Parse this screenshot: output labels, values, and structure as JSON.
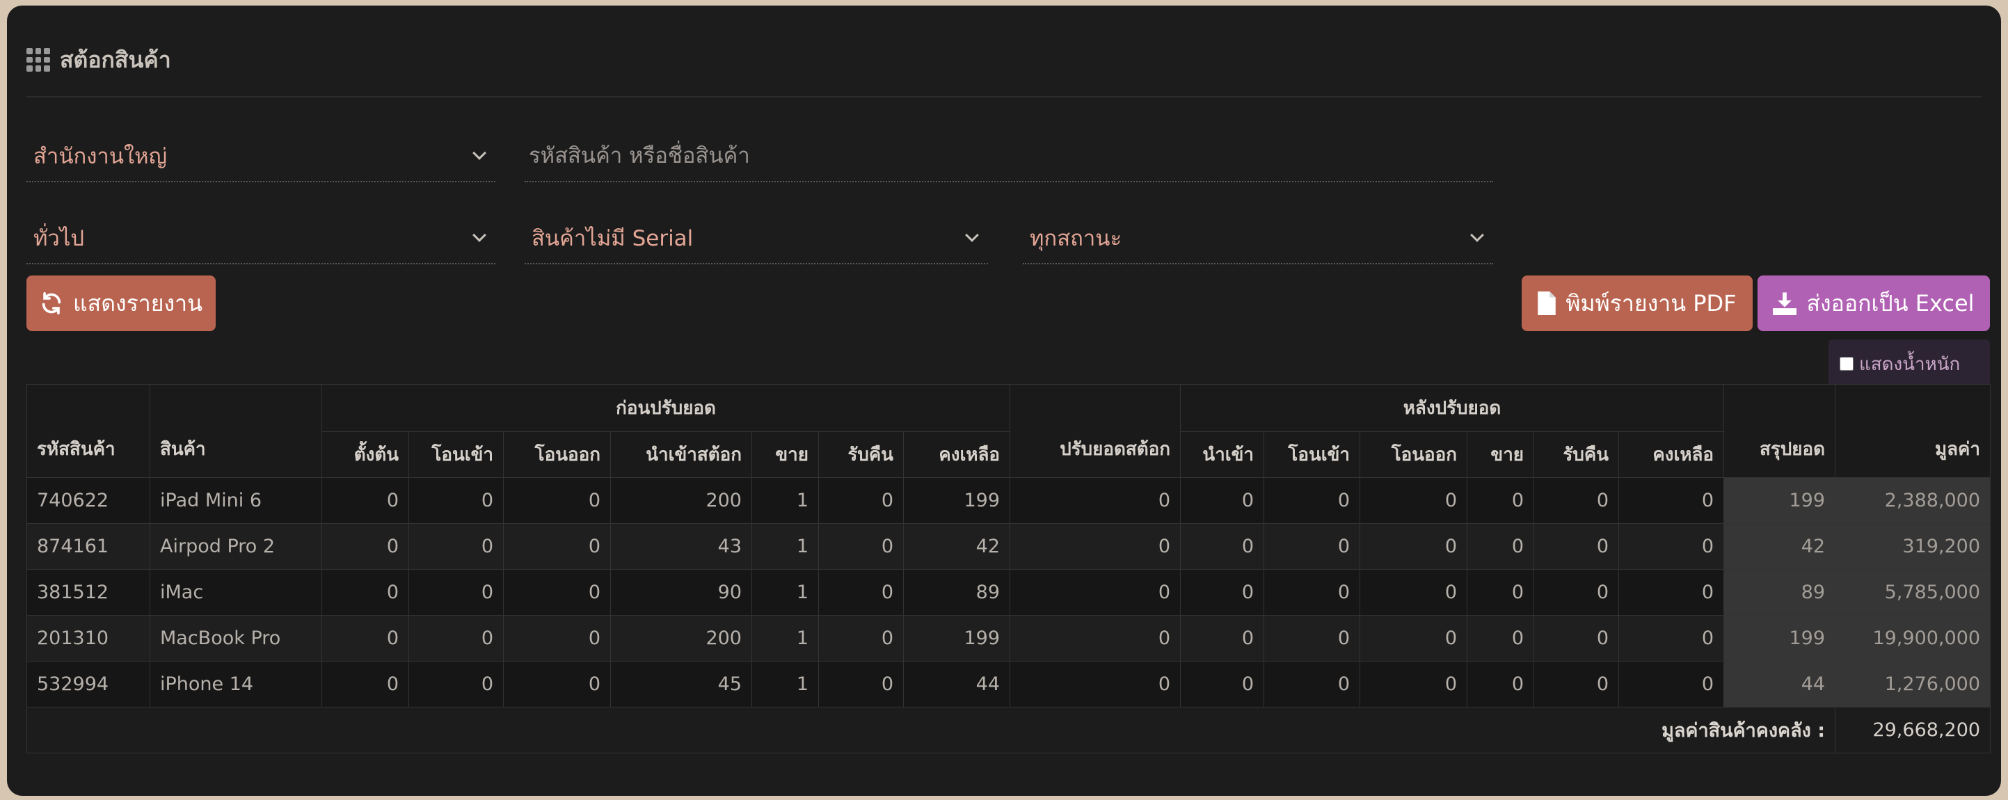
{
  "header": {
    "title": "สต้อกสินค้า",
    "icon": "grid-icon"
  },
  "filters": {
    "branch": "สำนักงานใหญ่",
    "search_placeholder": "รหัสสินค้า หรือชื่อสินค้า",
    "category": "ทั่วไป",
    "serial_type": "สินค้าไม่มี Serial",
    "status": "ทุกสถานะ"
  },
  "buttons": {
    "show_report": "แสดงรายงาน",
    "print_pdf": "พิมพ์รายงาน PDF",
    "export_excel": "ส่งออกเป็น Excel"
  },
  "options": {
    "show_weight": "แสดงน้ำหนัก"
  },
  "table": {
    "headers": {
      "code": "รหัสสินค้า",
      "product": "สินค้า",
      "before_group": "ก่อนปรับยอด",
      "adjust": "ปรับยอดสต้อก",
      "after_group": "หลังปรับยอด",
      "summary": "สรุปยอด",
      "value": "มูลค่า",
      "before": [
        "ตั้งต้น",
        "โอนเข้า",
        "โอนออก",
        "นำเข้าสต้อก",
        "ขาย",
        "รับคืน",
        "คงเหลือ"
      ],
      "after": [
        "นำเข้า",
        "โอนเข้า",
        "โอนออก",
        "ขาย",
        "รับคืน",
        "คงเหลือ"
      ]
    },
    "rows": [
      {
        "code": "740622",
        "name": "iPad Mini 6",
        "before": [
          "0",
          "0",
          "0",
          "200",
          "1",
          "0",
          "199"
        ],
        "adjust": "0",
        "after": [
          "0",
          "0",
          "0",
          "0",
          "0",
          "0"
        ],
        "summary": "199",
        "value": "2,388,000"
      },
      {
        "code": "874161",
        "name": "Airpod Pro 2",
        "before": [
          "0",
          "0",
          "0",
          "43",
          "1",
          "0",
          "42"
        ],
        "adjust": "0",
        "after": [
          "0",
          "0",
          "0",
          "0",
          "0",
          "0"
        ],
        "summary": "42",
        "value": "319,200"
      },
      {
        "code": "381512",
        "name": "iMac",
        "before": [
          "0",
          "0",
          "0",
          "90",
          "1",
          "0",
          "89"
        ],
        "adjust": "0",
        "after": [
          "0",
          "0",
          "0",
          "0",
          "0",
          "0"
        ],
        "summary": "89",
        "value": "5,785,000"
      },
      {
        "code": "201310",
        "name": "MacBook Pro",
        "before": [
          "0",
          "0",
          "0",
          "200",
          "1",
          "0",
          "199"
        ],
        "adjust": "0",
        "after": [
          "0",
          "0",
          "0",
          "0",
          "0",
          "0"
        ],
        "summary": "199",
        "value": "19,900,000"
      },
      {
        "code": "532994",
        "name": "iPhone 14",
        "before": [
          "0",
          "0",
          "0",
          "45",
          "1",
          "0",
          "44"
        ],
        "adjust": "0",
        "after": [
          "0",
          "0",
          "0",
          "0",
          "0",
          "0"
        ],
        "summary": "44",
        "value": "1,276,000"
      }
    ],
    "footer": {
      "label": "มูลค่าสินค้าคงคลัง :",
      "total": "29,668,200"
    }
  },
  "colors": {
    "accent": "#b96450",
    "excel": "#b161b4",
    "select_text": "#e3a595",
    "background": "#1c1c1c"
  }
}
